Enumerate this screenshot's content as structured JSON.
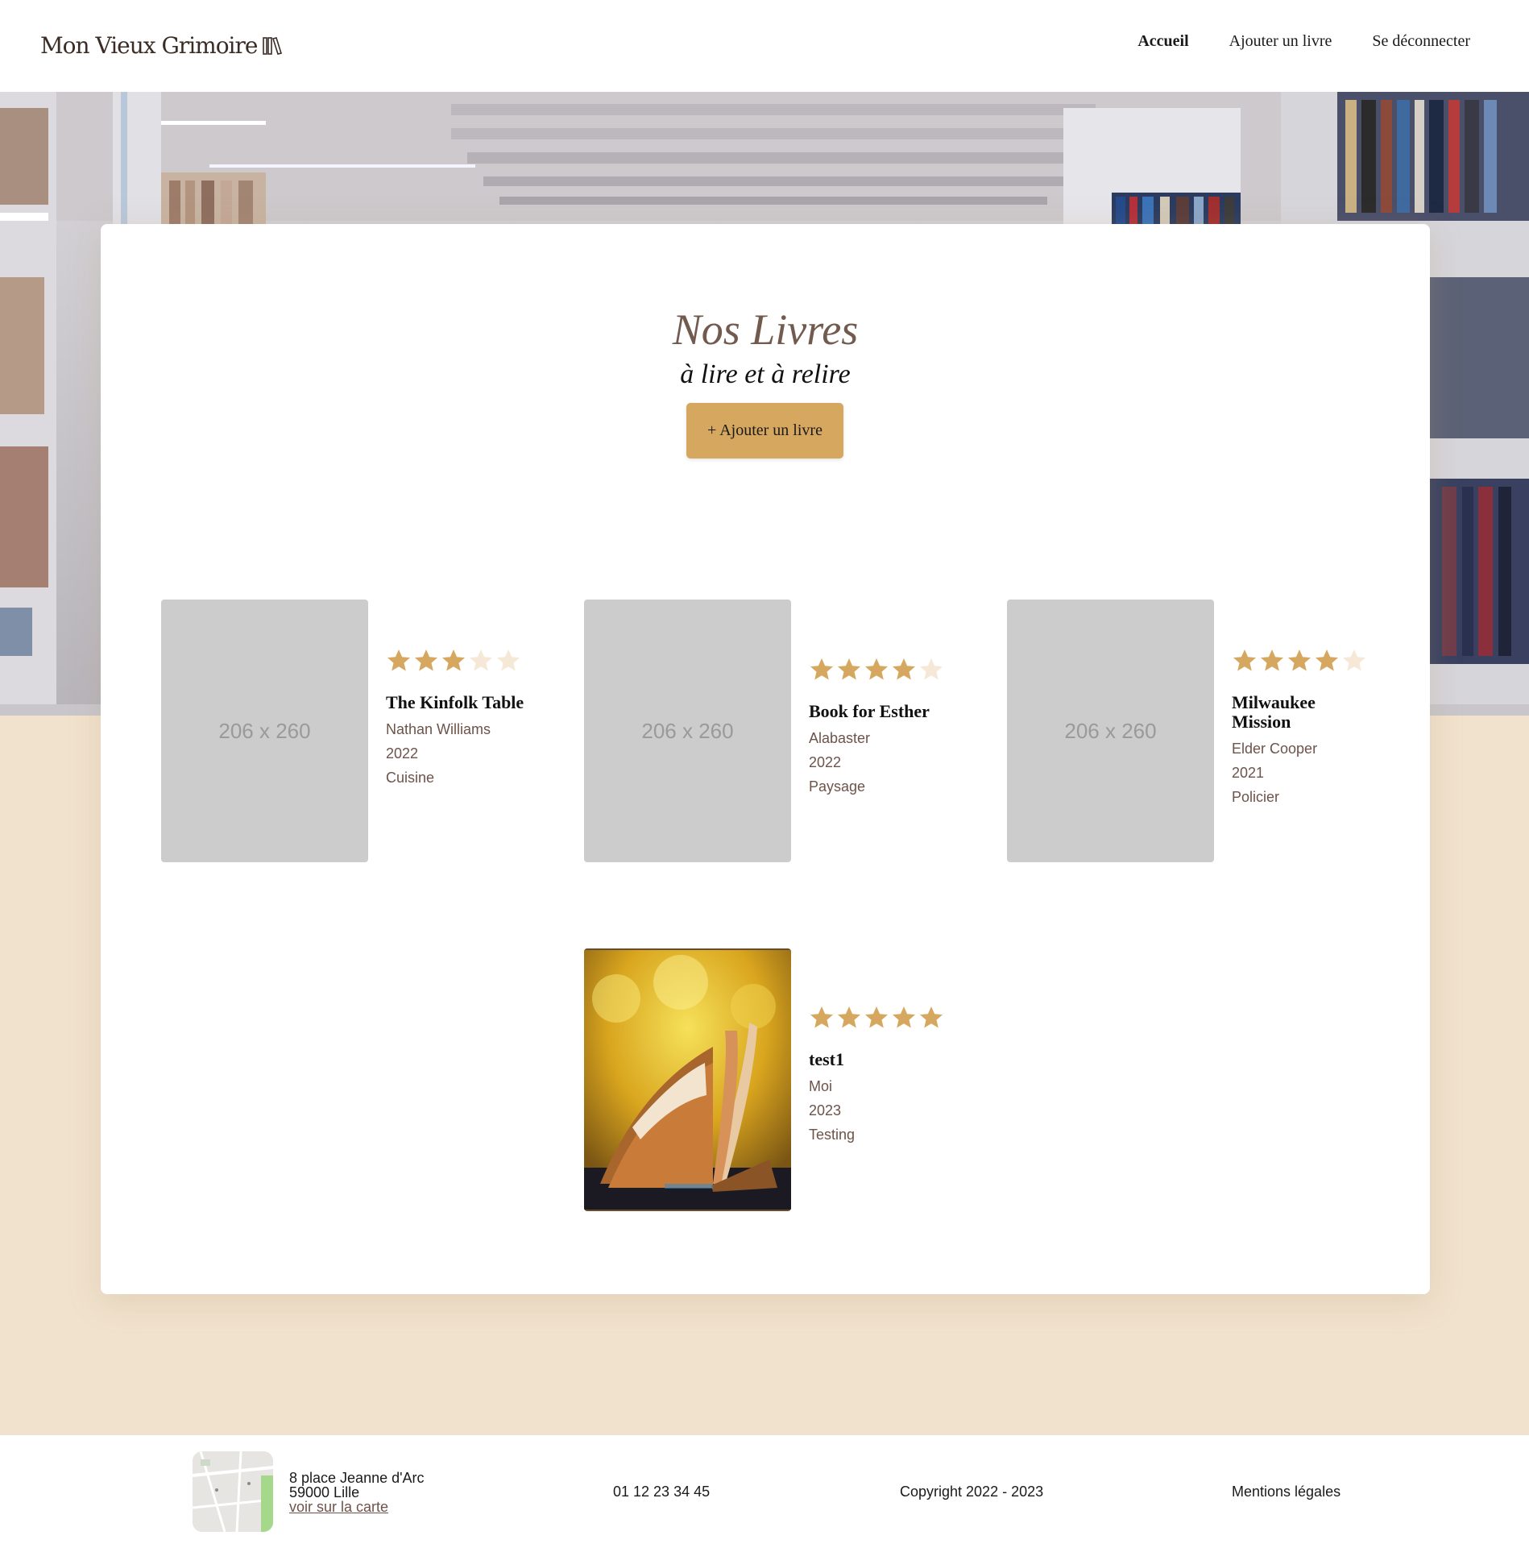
{
  "header": {
    "logo_text": "Mon Vieux Grimoire",
    "nav": [
      "Accueil",
      "Ajouter un livre",
      "Se déconnecter"
    ]
  },
  "main": {
    "title": "Nos Livres",
    "subtitle": "à lire et à relire",
    "add_button": "+ Ajouter un livre"
  },
  "books": [
    {
      "title": "The Kinfolk Table",
      "author": "Nathan Williams",
      "year": "2022",
      "genre": "Cuisine",
      "rating": 3,
      "cover_label": "206 x 260"
    },
    {
      "title": "Book for Esther",
      "author": "Alabaster",
      "year": "2022",
      "genre": "Paysage",
      "rating": 4,
      "cover_label": "206 x 260"
    },
    {
      "title": "Milwaukee Mission",
      "author": "Elder Cooper",
      "year": "2021",
      "genre": "Policier",
      "rating": 4,
      "cover_label": "206 x 260"
    },
    {
      "title": "test1",
      "author": "Moi",
      "year": "2023",
      "genre": "Testing",
      "rating": 5,
      "cover_label": ""
    }
  ],
  "footer": {
    "address_line1": "8 place Jeanne d'Arc",
    "address_line2": "59000 Lille",
    "map_link": "voir sur la carte",
    "phone": "01 12 23 34 45",
    "copyright": "Copyright 2022 - 2023",
    "legal": "Mentions légales"
  },
  "colors": {
    "accent": "#d6a75f",
    "star_filled": "#d6a75f",
    "star_empty": "#f5e8d6",
    "title_brown": "#725a4e",
    "background": "#f1e2cd"
  }
}
